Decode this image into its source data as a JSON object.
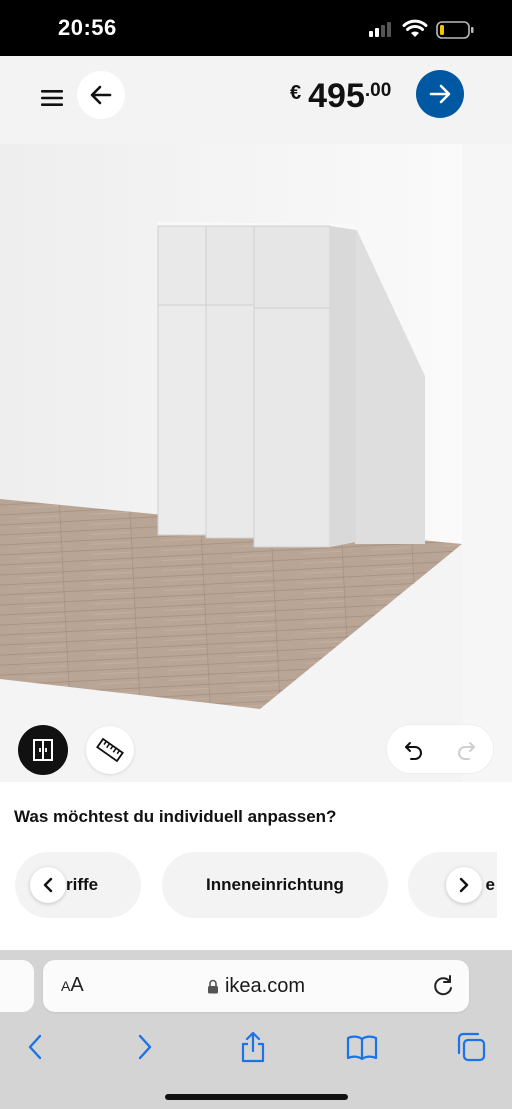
{
  "status_bar": {
    "time": "20:56",
    "icons": [
      "signal-icon",
      "wifi-icon",
      "battery-icon"
    ]
  },
  "header": {
    "menu_icon": "hamburger-menu-icon",
    "back_icon": "arrow-left-icon",
    "price": {
      "currency": "€",
      "main": "495",
      "cents": ".00"
    },
    "next_icon": "arrow-right-icon",
    "accent_color": "#0058a3"
  },
  "scene": {
    "tools": [
      "wardrobe-layout-icon",
      "ruler-icon"
    ],
    "undo_icon": "undo-icon",
    "redo_icon": "redo-icon",
    "redo_enabled": false
  },
  "customize": {
    "heading": "Was möchtest du individuell anpassen?",
    "options": [
      "riffe",
      "Inneneinrichtung",
      "e"
    ],
    "scroll_left_icon": "chevron-left-icon",
    "scroll_right_icon": "chevron-right-icon"
  },
  "browser": {
    "text_size_small": "A",
    "text_size_large": "A",
    "url": "ikea.com",
    "lock_icon": "lock-icon",
    "reload_icon": "reload-icon",
    "toolbar": [
      "back-icon",
      "forward-icon",
      "share-icon",
      "bookmarks-icon",
      "tabs-icon"
    ],
    "tint_color": "#1a73e8"
  }
}
